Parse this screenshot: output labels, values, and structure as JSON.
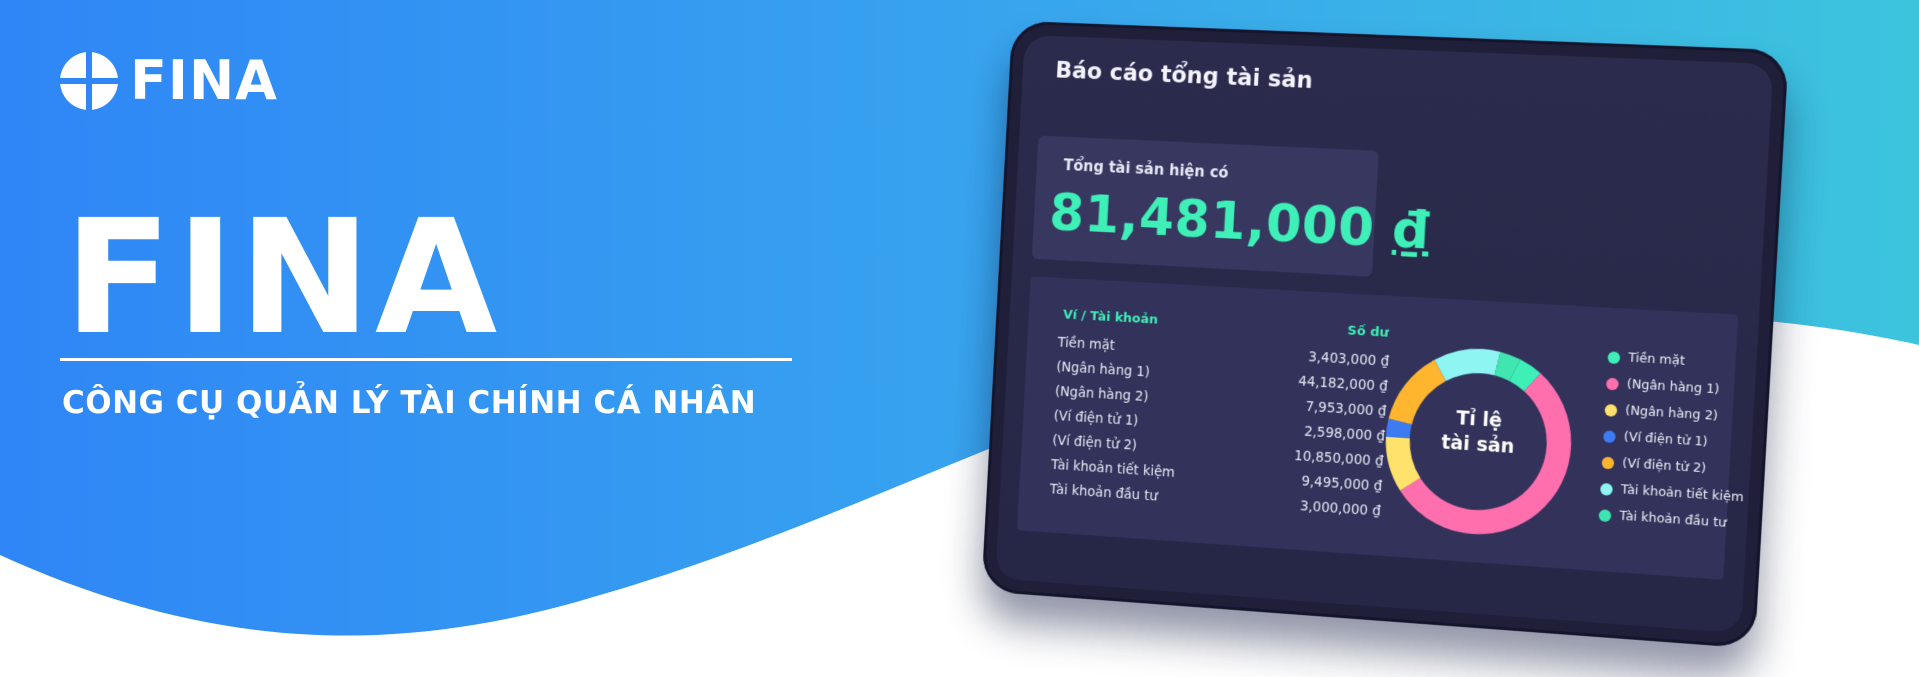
{
  "brand": {
    "logo_text": "FINA"
  },
  "hero": {
    "title": "FINA",
    "subtitle": "CÔNG CỤ QUẢN LÝ TÀI CHÍNH CÁ NHÂN"
  },
  "colors": {
    "accent": "#3ef0b7",
    "background_blue": "#2f8df5",
    "tablet": "#1f1f3a"
  },
  "report": {
    "title": "Báo cáo tổng tài sản",
    "total_label": "Tổng tài sản hiện có",
    "total_amount": "81,481,000",
    "currency": "₫",
    "col_account": "Ví / Tài khoản",
    "col_balance": "Số dư",
    "rows": [
      {
        "name": "Tiền mặt",
        "balance": "3,403,000 ₫"
      },
      {
        "name": "(Ngân hàng 1)",
        "balance": "44,182,000 ₫"
      },
      {
        "name": "(Ngân hàng 2)",
        "balance": "7,953,000 ₫"
      },
      {
        "name": "(Ví điện tử 1)",
        "balance": "2,598,000 ₫"
      },
      {
        "name": "(Ví điện tử 2)",
        "balance": "10,850,000 ₫"
      },
      {
        "name": "Tài khoản tiết kiệm",
        "balance": "9,495,000 ₫"
      },
      {
        "name": "Tài khoản đầu tư",
        "balance": "3,000,000 ₫"
      }
    ]
  },
  "chart_data": {
    "type": "pie",
    "title": "Tỉ lệ tài sản",
    "categories": [
      "Tiền mặt",
      "(Ngân hàng 1)",
      "(Ngân hàng 2)",
      "(Ví điện tử 1)",
      "(Ví điện tử 2)",
      "Tài khoản tiết kiệm",
      "Tài khoản đầu tư"
    ],
    "values": [
      3403000,
      44182000,
      7953000,
      2598000,
      10850000,
      9495000,
      3000000
    ],
    "colors": [
      "#3ef0b7",
      "#ff6fae",
      "#ffe26b",
      "#3d7bf2",
      "#ffb52e",
      "#8ff5f2",
      "#3fe6b0"
    ],
    "legend": "right"
  }
}
